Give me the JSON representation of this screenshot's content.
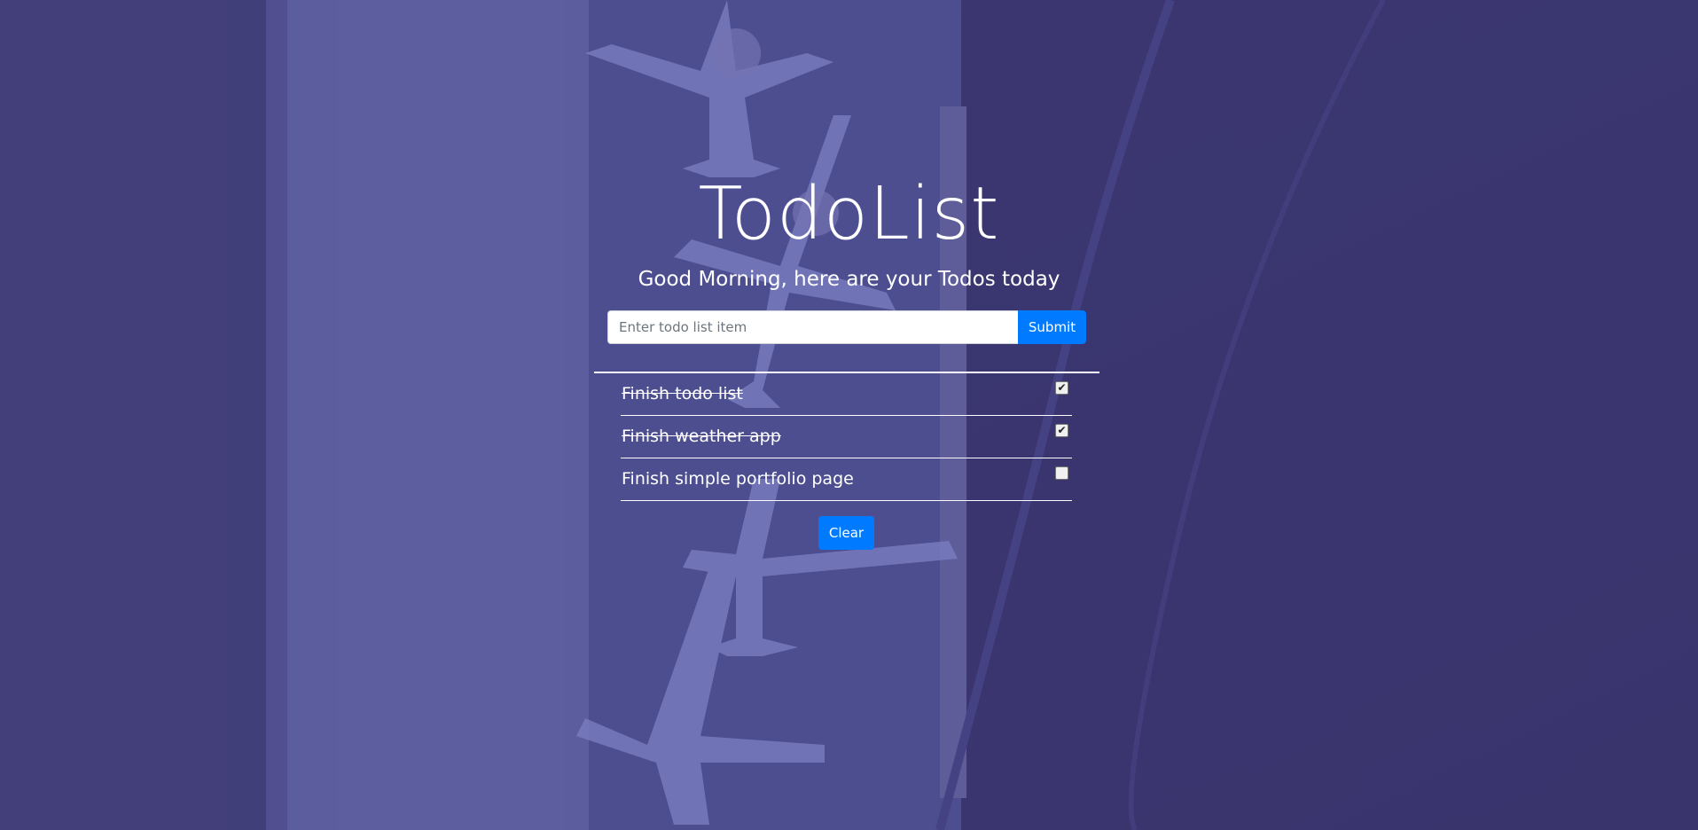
{
  "header": {
    "title": "TodoList",
    "subtitle": "Good Morning, here are your Todos today"
  },
  "form": {
    "placeholder": "Enter todo list item",
    "value": "",
    "submit_label": "Submit"
  },
  "todos": [
    {
      "text": "Finish todo list",
      "done": true
    },
    {
      "text": "Finish weather app",
      "done": true
    },
    {
      "text": "Finish simple portfolio page",
      "done": false
    }
  ],
  "clear_label": "Clear",
  "colors": {
    "accent": "#007bff",
    "overlay": "#3a3ea0",
    "text": "#ffffff"
  }
}
